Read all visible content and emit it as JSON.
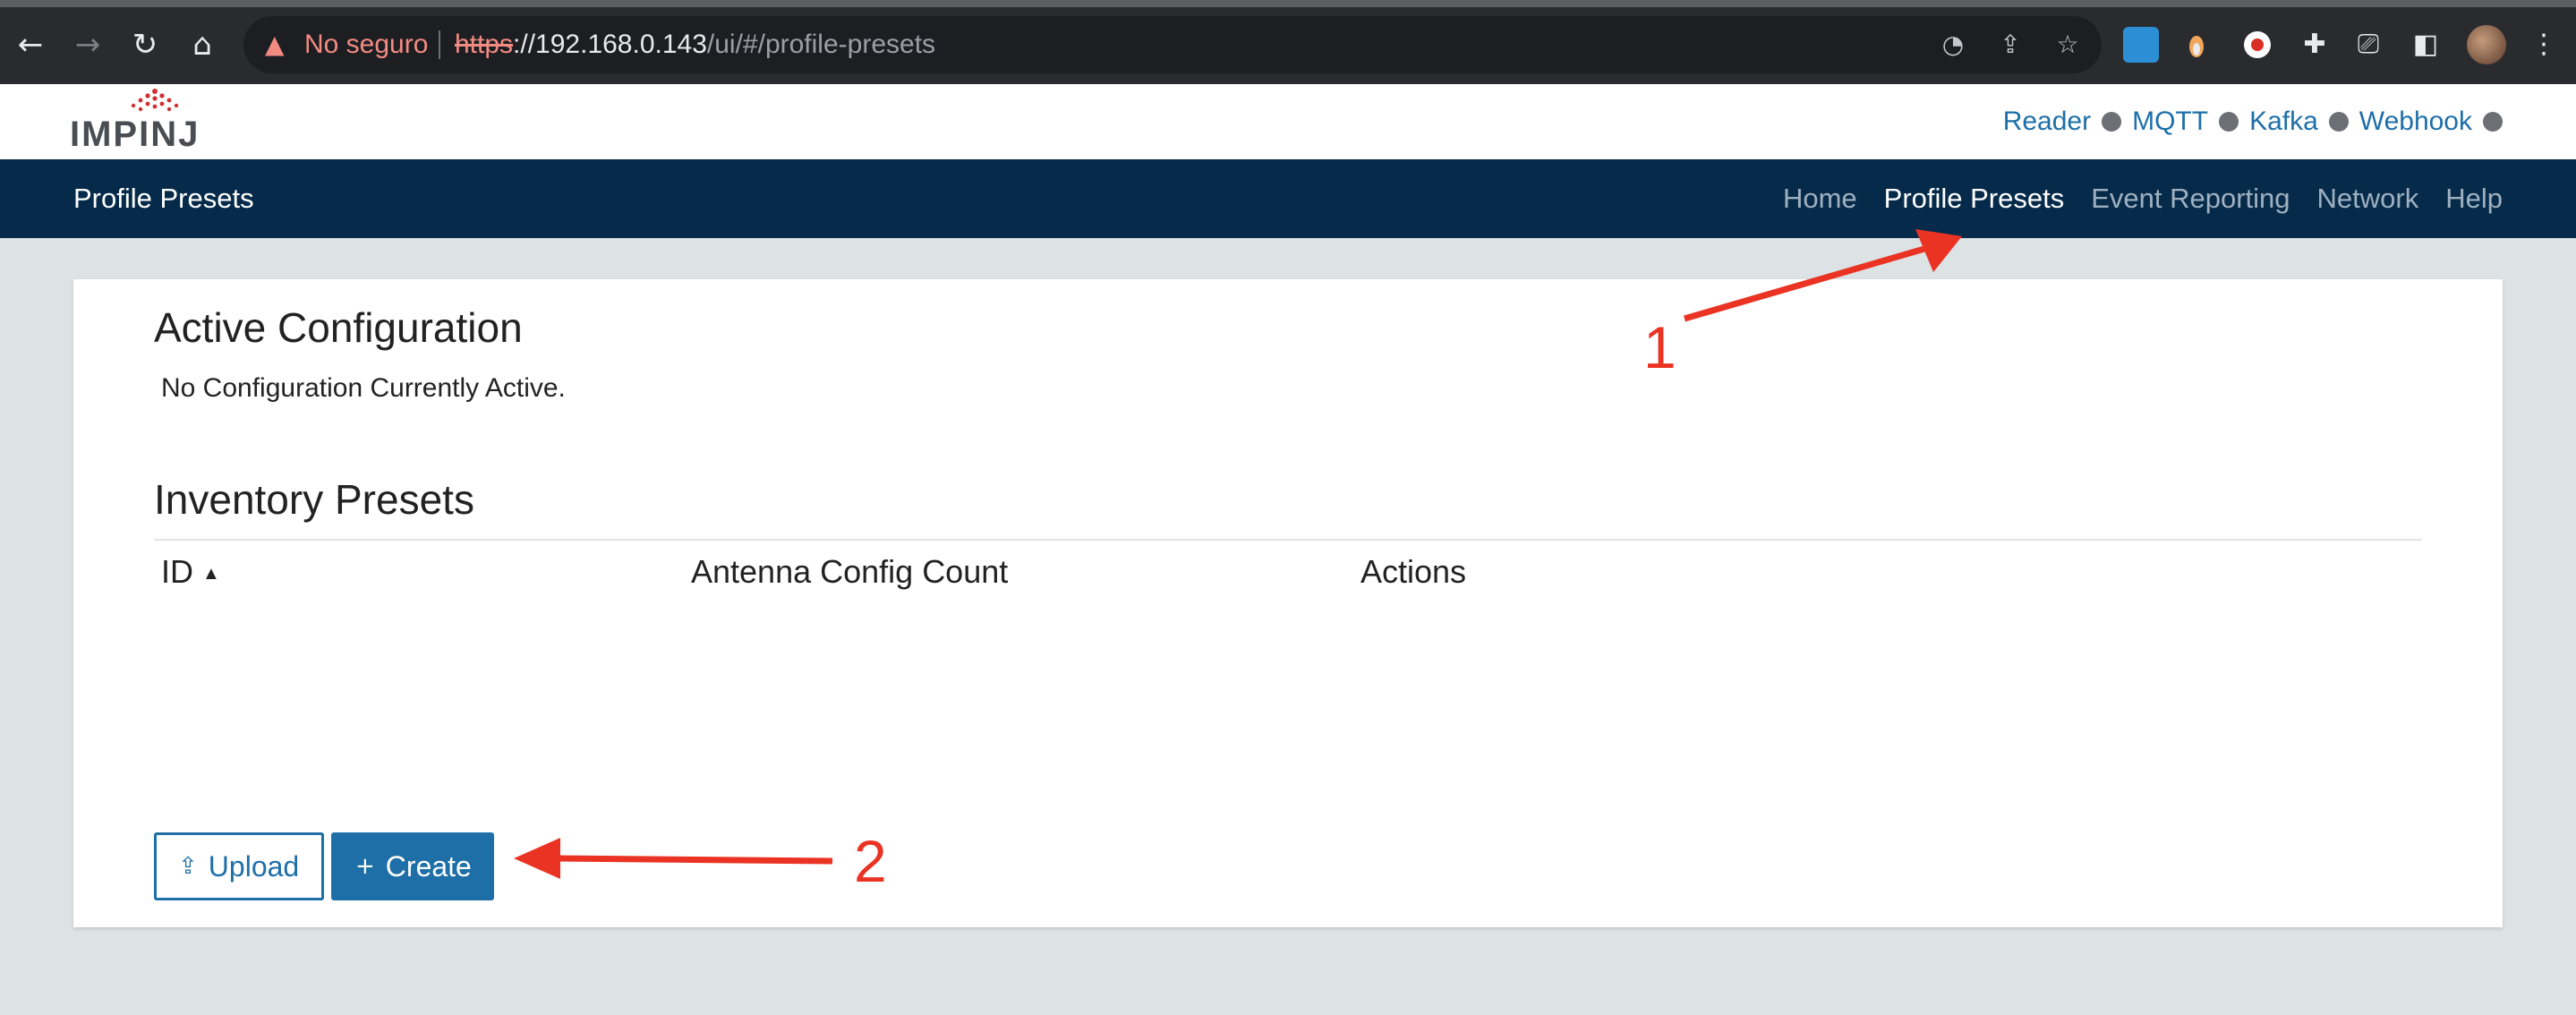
{
  "browser": {
    "security_warning": "No seguro",
    "url_scheme": "https",
    "url_host": "://192.168.0.143",
    "url_path": "/ui/#/profile-presets",
    "icons": [
      "back-icon",
      "forward-icon",
      "reload-icon",
      "home-icon",
      "performance-icon",
      "share-icon",
      "bookmark-star-icon",
      "extension-icons",
      "puzzle-icon",
      "cast-icon",
      "side-panel-icon",
      "profile-avatar",
      "menu-icon"
    ]
  },
  "header": {
    "logo_text": "IMPINJ",
    "status_links": [
      {
        "label": "Reader"
      },
      {
        "label": "MQTT"
      },
      {
        "label": "Kafka"
      },
      {
        "label": "Webhook"
      }
    ]
  },
  "navbar": {
    "brand": "Profile Presets",
    "links": [
      {
        "label": "Home",
        "active": false
      },
      {
        "label": "Profile Presets",
        "active": true
      },
      {
        "label": "Event Reporting",
        "active": false
      },
      {
        "label": "Network",
        "active": false
      },
      {
        "label": "Help",
        "active": false
      }
    ]
  },
  "active_config": {
    "title": "Active Configuration",
    "message": "No Configuration Currently Active."
  },
  "inventory": {
    "title": "Inventory Presets",
    "columns": [
      "ID",
      "Antenna Config Count",
      "Actions"
    ],
    "rows": []
  },
  "actions": {
    "upload_label": "Upload",
    "create_label": "Create"
  },
  "annotations": {
    "label_1": "1",
    "label_2": "2",
    "color": "#ea3323"
  },
  "colors": {
    "navbar_bg": "#062b4a",
    "link_blue": "#1e6fa8",
    "page_bg": "#dde2e5"
  }
}
